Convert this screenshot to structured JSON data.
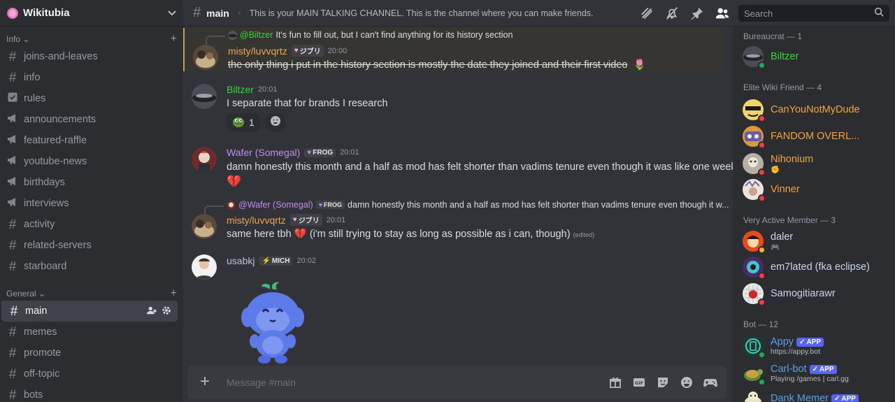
{
  "server": {
    "name": "Wikitubia"
  },
  "sidebar": {
    "categories": [
      {
        "label": "Info"
      },
      {
        "label": "General"
      }
    ],
    "info_channels": [
      {
        "label": "joins-and-leaves",
        "icon": "hash"
      },
      {
        "label": "info",
        "icon": "hash"
      },
      {
        "label": "rules",
        "icon": "rules-checkbox"
      },
      {
        "label": "announcements",
        "icon": "megaphone"
      },
      {
        "label": "featured-raffle",
        "icon": "megaphone"
      },
      {
        "label": "youtube-news",
        "icon": "megaphone"
      },
      {
        "label": "birthdays",
        "icon": "megaphone"
      },
      {
        "label": "interviews",
        "icon": "megaphone"
      },
      {
        "label": "activity",
        "icon": "hash"
      },
      {
        "label": "related-servers",
        "icon": "hash"
      },
      {
        "label": "starboard",
        "icon": "hash"
      }
    ],
    "general_channels": [
      {
        "label": "main",
        "icon": "hash",
        "active": true
      },
      {
        "label": "memes",
        "icon": "hash"
      },
      {
        "label": "promote",
        "icon": "hash"
      },
      {
        "label": "off-topic",
        "icon": "hash"
      },
      {
        "label": "bots",
        "icon": "hash"
      }
    ]
  },
  "header": {
    "channel": "main",
    "topic": "This is your MAIN TALKING CHANNEL. This is the channel where you can make friends.",
    "search_placeholder": "Search"
  },
  "messages": {
    "m1": {
      "reply_user": "@Biltzer",
      "reply_text": "It's fun to fill out, but I can't find anything for its history section",
      "user": "misty/luvvqrtz",
      "user_color": "#e8a557",
      "badge": "ジブリ",
      "time": "20:00",
      "text": "the only thing i put in the history section is mostly the date they joined and their first video"
    },
    "m2": {
      "user": "Biltzer",
      "user_color": "#3ad53a",
      "time": "20:01",
      "text": "I separate that for brands I research",
      "reaction_count": "1"
    },
    "m3": {
      "user": "Wafer (Somegal)",
      "user_color": "#c28cf0",
      "badge": "FROG",
      "time": "20:01",
      "text": "damn honestly this month and a half as mod has felt shorter than vadims tenure even though it was like one week"
    },
    "m4": {
      "reply_user": "@Wafer (Somegal)",
      "reply_badge": "FROG",
      "reply_text": "damn honestly this month and a half as mod has felt shorter than vadims tenure even though it w...",
      "user": "misty/luvvqrtz",
      "user_color": "#e8a557",
      "badge": "ジブリ",
      "time": "20:01",
      "text_before": "same here tbh",
      "text_after": "(i'm still trying to stay as long as possible as i can, though)",
      "edited": "(edited)"
    },
    "m5": {
      "user": "usabkj",
      "user_color": "#b8c4d6",
      "badge": "MICH",
      "time": "20:02"
    }
  },
  "composer": {
    "placeholder": "Message #main"
  },
  "members": {
    "groups": [
      {
        "label": "Bureaucrat — 1"
      },
      {
        "label": "Elite Wiki Friend — 4"
      },
      {
        "label": "Very Active Member — 3"
      },
      {
        "label": "Bot — 12"
      }
    ],
    "list": [
      {
        "name": "Biltzer",
        "color": "#3ad53a",
        "status": "online"
      },
      {
        "name": "CanYouNotMyDude",
        "color": "#f5a33c",
        "status": "dnd"
      },
      {
        "name": "FANDOM OVERL...",
        "color": "#f5a33c",
        "status": "dnd"
      },
      {
        "name": "Nihonium",
        "color": "#f5a33c",
        "status": "dnd"
      },
      {
        "name": "Vinner",
        "color": "#f5a33c",
        "status": "dnd"
      },
      {
        "name": "daler",
        "color": "#c9d4ec",
        "status": "idle"
      },
      {
        "name": "em7lated (fka eclipse)",
        "color": "#c9d4ec",
        "status": "dnd"
      },
      {
        "name": "Samogitiarawr",
        "color": "#c9d4ec",
        "status": "dnd"
      },
      {
        "name": "Appy",
        "color": "#5aa0e8",
        "status": "online",
        "sub": "https://appy.bot"
      },
      {
        "name": "Carl-bot",
        "color": "#5aa0e8",
        "status": "online",
        "sub": "Playing /games | carl.gg"
      },
      {
        "name": "Dank Memer",
        "color": "#5aa0e8",
        "status": "online"
      }
    ],
    "app_badge": "APP"
  }
}
